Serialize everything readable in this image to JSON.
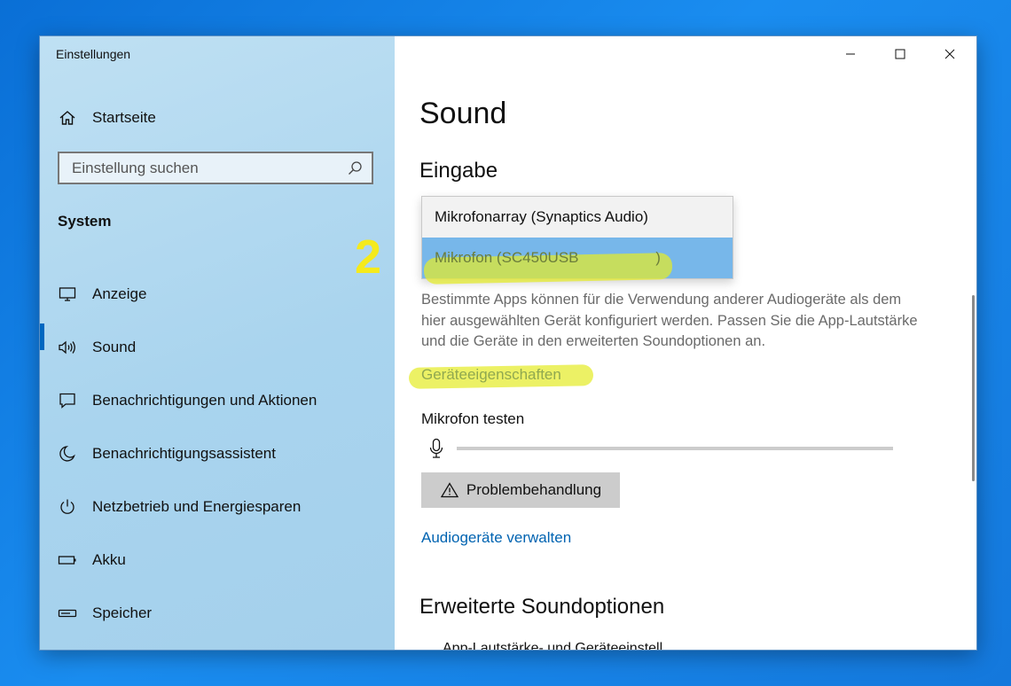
{
  "window": {
    "title": "Einstellungen",
    "controls": {
      "minimize": "—",
      "maximize": "☐",
      "close": "✕"
    }
  },
  "sidebar": {
    "home": "Startseite",
    "search_placeholder": "Einstellung suchen",
    "section": "System",
    "items": [
      {
        "label": "Anzeige",
        "icon": "monitor-icon"
      },
      {
        "label": "Sound",
        "icon": "speaker-icon",
        "active": true
      },
      {
        "label": "Benachrichtigungen und Aktionen",
        "icon": "notification-icon"
      },
      {
        "label": "Benachrichtigungsassistent",
        "icon": "moon-icon"
      },
      {
        "label": "Netzbetrieb und Energiesparen",
        "icon": "power-icon"
      },
      {
        "label": "Akku",
        "icon": "battery-icon"
      },
      {
        "label": "Speicher",
        "icon": "storage-icon"
      }
    ]
  },
  "main": {
    "title": "Sound",
    "input_heading": "Eingabe",
    "dropdown_options": [
      {
        "label": "Mikrofonarray (Synaptics Audio)"
      },
      {
        "label": "Mikrofon (SC450USB",
        "suffix": ")",
        "selected": true
      }
    ],
    "annotation": "2",
    "description": "Bestimmte Apps können für die Verwendung anderer Audiogeräte als dem hier ausgewählten Gerät konfiguriert werden. Passen Sie die App-Lautstärke und die Geräte in den erweiterten Soundoptionen an.",
    "device_properties_link": "Geräteeigenschaften",
    "mic_test_label": "Mikrofon testen",
    "mic_level": 0,
    "troubleshoot_button": "Problembehandlung",
    "manage_devices_link": "Audiogeräte verwalten",
    "advanced_heading": "Erweiterte Soundoptionen",
    "cut_off_text": "App-Lautstärke- und Geräteeinstell..."
  },
  "colors": {
    "accent": "#0067c0",
    "link": "#0063b1",
    "highlight": "#e4eb28",
    "annotation": "#f5ea1c",
    "dropdown_selected": "#77b7ea"
  }
}
